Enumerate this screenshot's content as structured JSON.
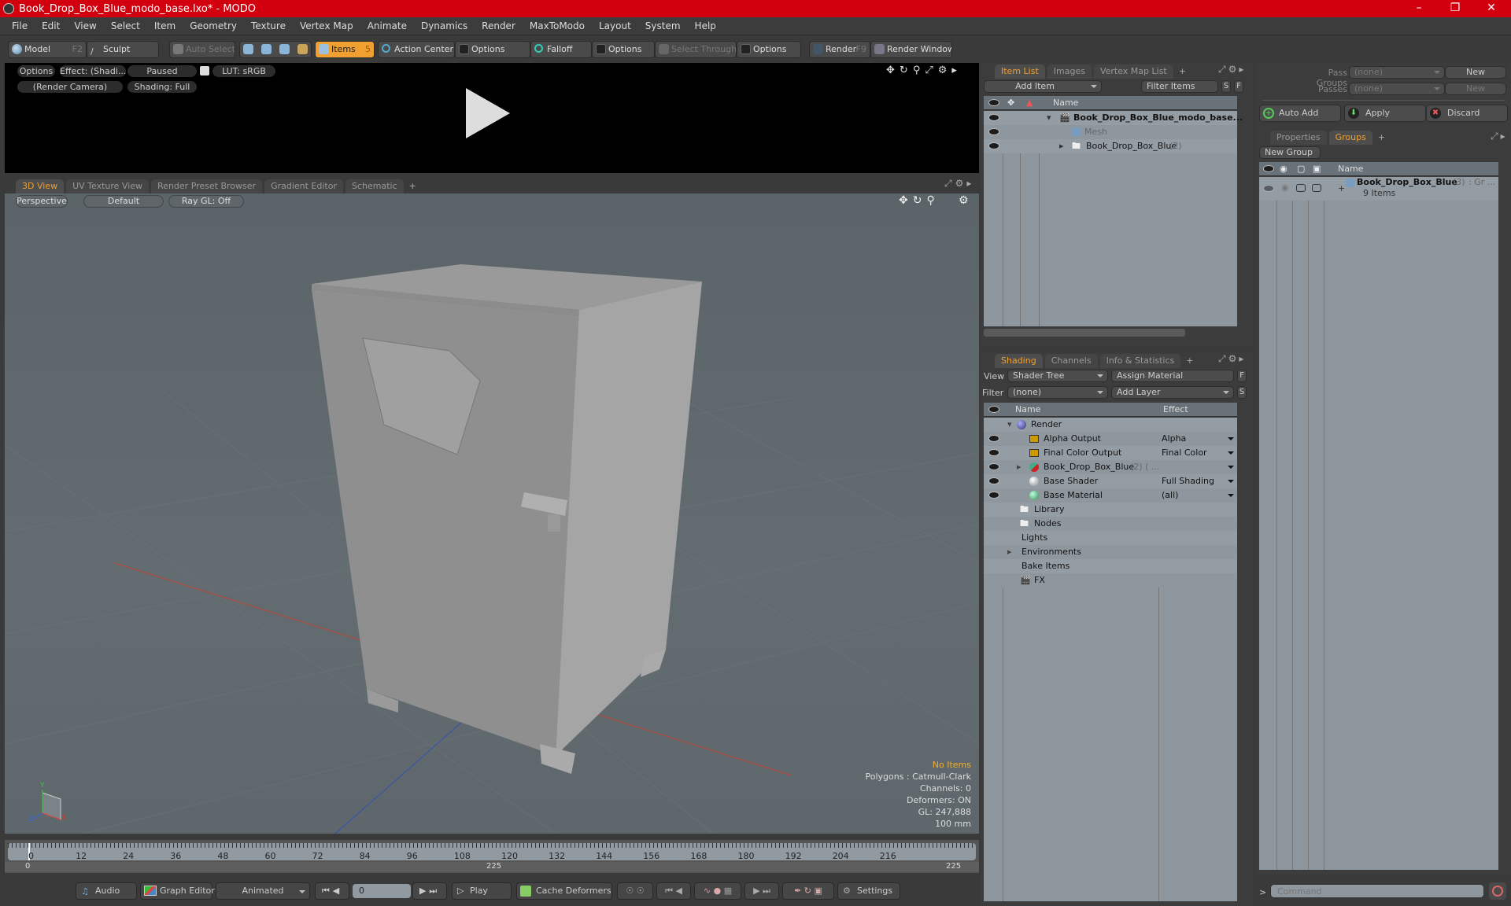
{
  "window": {
    "title": "Book_Drop_Box_Blue_modo_base.lxo* - MODO",
    "controls": [
      "minimize",
      "maximize",
      "close"
    ]
  },
  "menu": [
    "File",
    "Edit",
    "View",
    "Select",
    "Item",
    "Geometry",
    "Texture",
    "Vertex Map",
    "Animate",
    "Dynamics",
    "Render",
    "MaxToModo",
    "Layout",
    "System",
    "Help"
  ],
  "toolbar": {
    "model": "Model",
    "model_key": "F2",
    "sculpt": "Sculpt",
    "auto_select": "Auto Select",
    "items": "Items",
    "items_key": "5",
    "action_center": "Action Center",
    "options1": "Options",
    "falloff": "Falloff",
    "options2": "Options",
    "select_through": "Select Through",
    "options3": "Options",
    "render": "Render",
    "render_key": "F9",
    "render_window": "Render Window"
  },
  "render_preview": {
    "options": "Options",
    "effect": "Effect: (Shadi...",
    "paused": "Paused",
    "lut": "LUT: sRGB",
    "camera": "(Render Camera)",
    "shading": "Shading: Full"
  },
  "viewport_tabs": [
    {
      "label": "3D View",
      "active": true
    },
    {
      "label": "UV Texture View"
    },
    {
      "label": "Render Preset Browser"
    },
    {
      "label": "Gradient Editor"
    },
    {
      "label": "Schematic"
    },
    {
      "label": "+"
    }
  ],
  "viewport": {
    "projection": "Perspective",
    "style": "Default",
    "raygl": "Ray GL: Off",
    "hud": {
      "selection": "No Items",
      "polygons": "Polygons : Catmull-Clark",
      "channels": "Channels: 0",
      "deformers": "Deformers: ON",
      "gl": "GL: 247,888",
      "unit": "100 mm"
    },
    "axis": {
      "x": "X",
      "y": "Y",
      "z": "Z"
    }
  },
  "timeline": {
    "ticks": [
      "0",
      "12",
      "24",
      "36",
      "48",
      "60",
      "72",
      "84",
      "96",
      "108",
      "120",
      "132",
      "144",
      "156",
      "168",
      "180",
      "192",
      "204",
      "216"
    ],
    "range_start": "0",
    "range_mid": "225",
    "range_end": "225"
  },
  "bottombar": {
    "audio": "Audio",
    "graph_editor": "Graph Editor",
    "animated": "Animated",
    "frame": "0",
    "play": "Play",
    "cache_deformers": "Cache Deformers",
    "settings": "Settings"
  },
  "item_list": {
    "tabs": [
      {
        "label": "Item List",
        "active": true
      },
      {
        "label": "Images"
      },
      {
        "label": "Vertex Map List"
      },
      {
        "label": "+"
      }
    ],
    "add_item": "Add Item",
    "filter": "Filter Items",
    "s": "S",
    "f": "F",
    "col_name": "Name",
    "rows": [
      {
        "name": "Book_Drop_Box_Blue_modo_base...",
        "bold": true,
        "icon": "scene-icon"
      },
      {
        "name": "Mesh",
        "dim": true,
        "icon": "mesh-icon"
      },
      {
        "name": "Book_Drop_Box_Blue",
        "count": "(2)",
        "icon": "group-folder-icon"
      }
    ]
  },
  "shading": {
    "tabs": [
      {
        "label": "Shading",
        "active": true
      },
      {
        "label": "Channels"
      },
      {
        "label": "Info & Statistics"
      },
      {
        "label": "+"
      }
    ],
    "view_label": "View",
    "view_value": "Shader Tree",
    "assign_material": "Assign Material",
    "f": "F",
    "filter_label": "Filter",
    "filter_value": "(none)",
    "add_layer": "Add Layer",
    "s": "S",
    "col_name": "Name",
    "col_effect": "Effect",
    "rows": [
      {
        "name": "Render",
        "effect": "",
        "icon": "render-sphere-icon"
      },
      {
        "name": "Alpha Output",
        "effect": "Alpha",
        "icon": "output-icon"
      },
      {
        "name": "Final Color Output",
        "effect": "Final Color",
        "icon": "output-icon"
      },
      {
        "name": "Book_Drop_Box_Blue",
        "suffix": "(2) ( ...",
        "effect": "",
        "icon": "material-group-icon"
      },
      {
        "name": "Base Shader",
        "effect": "Full Shading",
        "icon": "shader-icon"
      },
      {
        "name": "Base Material",
        "effect": "(all)",
        "icon": "material-icon"
      },
      {
        "name": "Library",
        "icon": "folder-icon"
      },
      {
        "name": "Nodes",
        "icon": "folder-icon"
      },
      {
        "name": "Lights"
      },
      {
        "name": "Environments"
      },
      {
        "name": "Bake Items"
      },
      {
        "name": "FX",
        "icon": "fx-icon"
      }
    ]
  },
  "passes": {
    "pass_groups_label": "Pass Groups",
    "pass_groups_value": "(none)",
    "new1": "New",
    "passes_label": "Passes",
    "passes_value": "(none)",
    "new2": "New",
    "auto_add": "Auto Add",
    "apply": "Apply",
    "discard": "Discard"
  },
  "groups": {
    "tabs": [
      {
        "label": "Properties"
      },
      {
        "label": "Groups",
        "active": true
      },
      {
        "label": "+"
      }
    ],
    "new_group": "New Group",
    "col_name": "Name",
    "row": {
      "name": "Book_Drop_Box_Blue",
      "count": "(3)",
      "suffix": ": Gr ...",
      "sub": "9 Items"
    }
  },
  "command": {
    "placeholder": "Command",
    "prompt": ">"
  }
}
